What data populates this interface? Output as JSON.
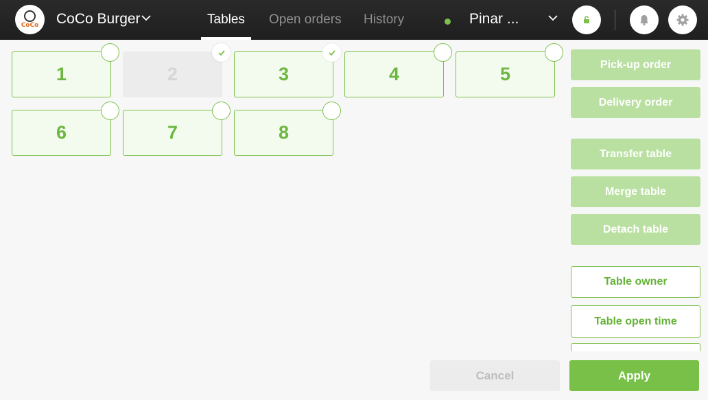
{
  "header": {
    "logo_text": "CoCo",
    "store_name": "CoCo Burger",
    "tabs": [
      {
        "label": "Tables",
        "active": true
      },
      {
        "label": "Open orders",
        "active": false
      },
      {
        "label": "History",
        "active": false
      }
    ],
    "user_name": "Pinar ...",
    "status_color": "#7cc04b"
  },
  "tables": [
    {
      "label": "1",
      "disabled": false,
      "selected": false
    },
    {
      "label": "2",
      "disabled": true,
      "selected": true
    },
    {
      "label": "3",
      "disabled": false,
      "selected": true
    },
    {
      "label": "4",
      "disabled": false,
      "selected": false
    },
    {
      "label": "5",
      "disabled": false,
      "selected": false
    },
    {
      "label": "6",
      "disabled": false,
      "selected": false
    },
    {
      "label": "7",
      "disabled": false,
      "selected": false
    },
    {
      "label": "8",
      "disabled": false,
      "selected": false
    }
  ],
  "actions": {
    "pickup": "Pick-up order",
    "delivery": "Delivery order",
    "transfer": "Transfer table",
    "merge": "Merge table",
    "detach": "Detach table",
    "owner": "Table owner",
    "open_time": "Table open time"
  },
  "footer": {
    "cancel": "Cancel",
    "apply": "Apply"
  },
  "colors": {
    "accent": "#7cc04b",
    "accent_light": "#b9e0a1",
    "header_bg": "#242424"
  }
}
